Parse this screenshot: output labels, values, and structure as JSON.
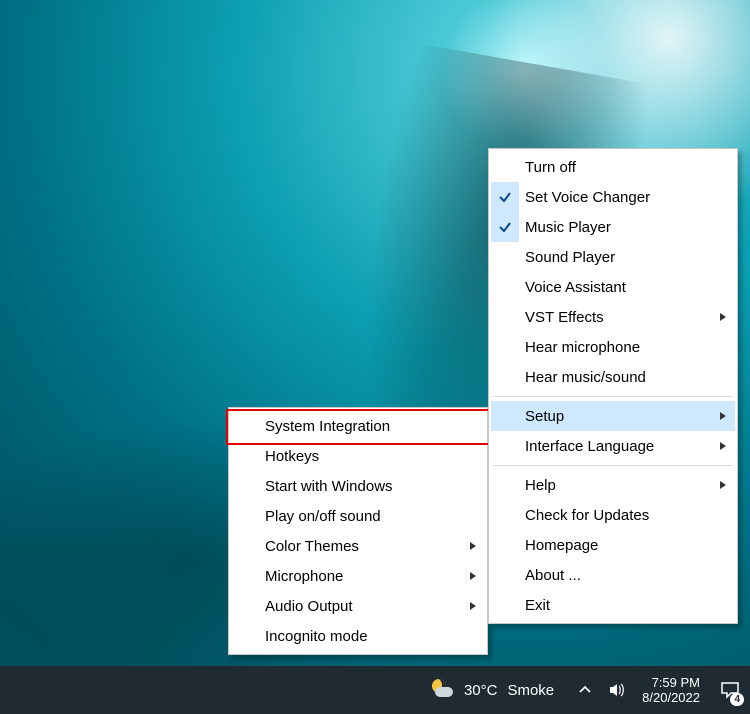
{
  "submenu": {
    "items": [
      {
        "label": "System Integration",
        "highlighted": true
      },
      {
        "label": "Hotkeys"
      },
      {
        "label": "Start with Windows"
      },
      {
        "label": "Play on/off sound"
      },
      {
        "label": "Color Themes",
        "submenu": true
      },
      {
        "label": "Microphone",
        "submenu": true
      },
      {
        "label": "Audio Output",
        "submenu": true
      },
      {
        "label": "Incognito mode"
      }
    ]
  },
  "mainmenu": {
    "groups": [
      [
        {
          "label": "Turn off"
        },
        {
          "label": "Set Voice Changer",
          "checked": true
        },
        {
          "label": "Music Player",
          "checked": true
        },
        {
          "label": "Sound Player"
        },
        {
          "label": "Voice Assistant"
        },
        {
          "label": "VST Effects",
          "submenu": true
        },
        {
          "label": "Hear microphone"
        },
        {
          "label": "Hear music/sound"
        }
      ],
      [
        {
          "label": "Setup",
          "submenu": true,
          "hover": true
        },
        {
          "label": "Interface Language",
          "submenu": true
        }
      ],
      [
        {
          "label": "Help",
          "submenu": true
        },
        {
          "label": "Check for Updates"
        },
        {
          "label": "Homepage"
        },
        {
          "label": "About ..."
        },
        {
          "label": "Exit"
        }
      ]
    ]
  },
  "taskbar": {
    "weather_temp": "30°C",
    "weather_cond": "Smoke",
    "time": "7:59 PM",
    "date": "8/20/2022",
    "notif_count": "4"
  }
}
